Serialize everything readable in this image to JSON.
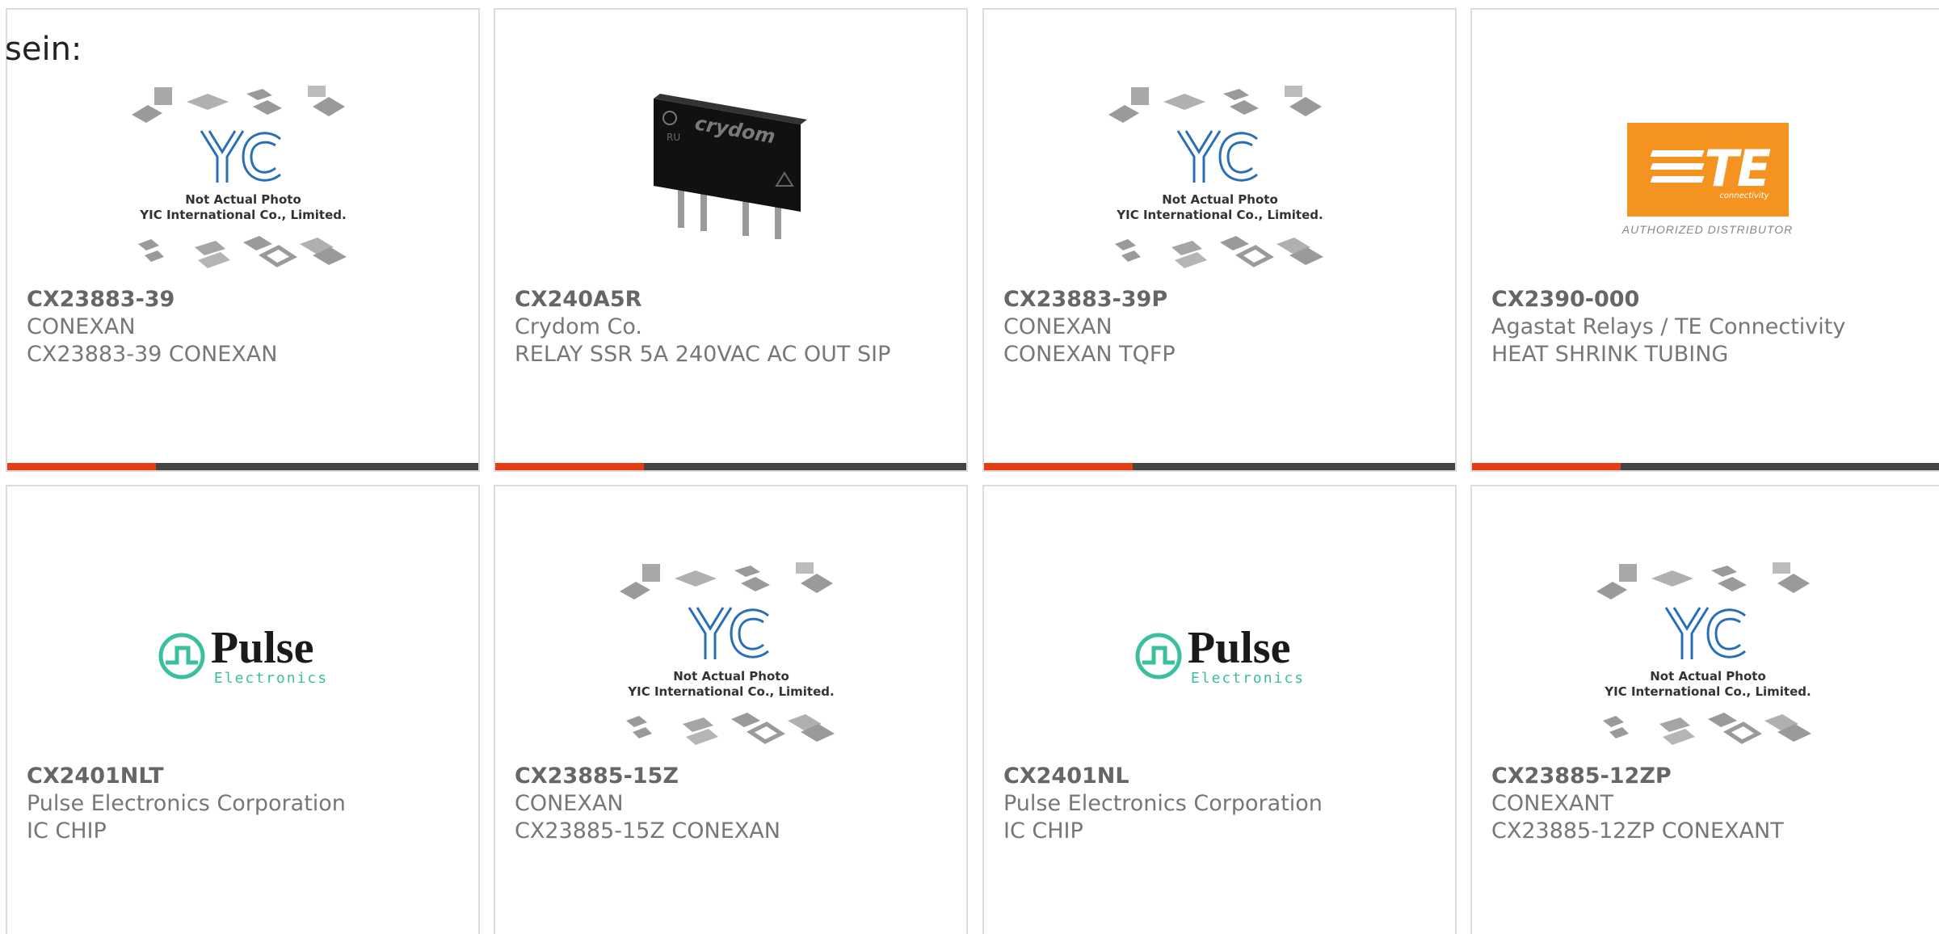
{
  "intro_text": "sein:",
  "colors": {
    "accent": "#e53c11",
    "bar": "#444444",
    "border": "#dcdcdc",
    "te_orange": "#f49320",
    "pulse_teal": "#3cbf9e",
    "yic_blue": "#2a6fb5"
  },
  "placeholder_image": {
    "line1": "Not Actual Photo",
    "line2": "YIC International Co., Limited.",
    "logo": "YIC"
  },
  "te_logo": {
    "mark": "TE",
    "sub": "connectivity",
    "distributor": "AUTHORIZED DISTRIBUTOR"
  },
  "pulse_logo": {
    "main": "Pulse",
    "sub": "Electronics"
  },
  "crydom_image": {
    "brand": "crydom"
  },
  "products": [
    {
      "part_number": "CX23883-39",
      "manufacturer": "CONEXAN",
      "description": "CX23883-39 CONEXAN",
      "image": "yic-placeholder"
    },
    {
      "part_number": "CX240A5R",
      "manufacturer": "Crydom Co.",
      "description": "RELAY SSR 5A 240VAC AC OUT SIP",
      "image": "crydom-relay"
    },
    {
      "part_number": "CX23883-39P",
      "manufacturer": "CONEXAN",
      "description": "CONEXAN TQFP",
      "image": "yic-placeholder"
    },
    {
      "part_number": "CX2390-000",
      "manufacturer": "Agastat Relays / TE Connectivity",
      "description": "HEAT SHRINK TUBING",
      "image": "te-logo"
    },
    {
      "part_number": "CX2401NLT",
      "manufacturer": "Pulse Electronics Corporation",
      "description": "IC CHIP",
      "image": "pulse-logo"
    },
    {
      "part_number": "CX23885-15Z",
      "manufacturer": "CONEXAN",
      "description": "CX23885-15Z CONEXAN",
      "image": "yic-placeholder"
    },
    {
      "part_number": "CX2401NL",
      "manufacturer": "Pulse Electronics Corporation",
      "description": "IC CHIP",
      "image": "pulse-logo"
    },
    {
      "part_number": "CX23885-12ZP",
      "manufacturer": "CONEXANT",
      "description": "CX23885-12ZP CONEXANT",
      "image": "yic-placeholder"
    }
  ]
}
